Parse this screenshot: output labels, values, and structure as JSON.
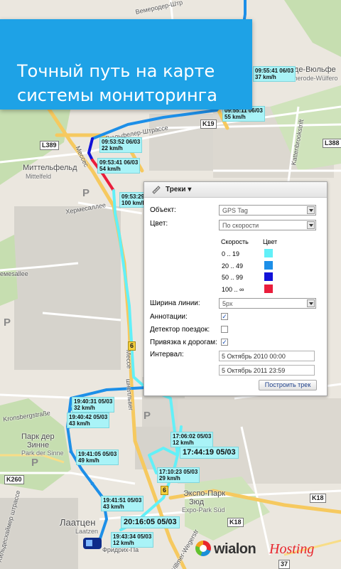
{
  "banner": {
    "line1": "Точный путь на карте",
    "line2": "системы мониторинга"
  },
  "map": {
    "places": [
      {
        "id": "mittelfeld",
        "text": "Миттельфельд"
      },
      {
        "id": "mittelfeld_de",
        "text": "Mittelfeld"
      },
      {
        "id": "bemerode",
        "text": "еroде-Вюльфе"
      },
      {
        "id": "bemerode_de",
        "text": "Bemerode-Wülfero"
      },
      {
        "id": "park_sinne",
        "text": "Парк дер"
      },
      {
        "id": "park_sinne2",
        "text": "Зинне"
      },
      {
        "id": "park_sinne_de",
        "text": "Park der Sinne"
      },
      {
        "id": "laatzen",
        "text": "Лаатцен"
      },
      {
        "id": "laatzen_de",
        "text": "Laatzen"
      },
      {
        "id": "expo",
        "text": "Экспо-Парк"
      },
      {
        "id": "expo2",
        "text": "Зюд"
      },
      {
        "id": "expo_de",
        "text": "Expo-Park Süd"
      }
    ],
    "streets": [
      {
        "id": "vemeroder",
        "text": "Вемеродер-Штр"
      },
      {
        "id": "wulfeler",
        "text": "Вюльфелер-Штрассе"
      },
      {
        "id": "hermes",
        "text": "Хермесаллее"
      },
      {
        "id": "kronsberg",
        "text": "Kronsbergstraße"
      },
      {
        "id": "hildes",
        "text": "Хильдесхаймер штрассе"
      },
      {
        "id": "kattenbrook",
        "text": "Kattenbrookstrift"
      },
      {
        "id": "messe",
        "text": "Мессе"
      },
      {
        "id": "messe2",
        "text": "шнелльвег"
      },
      {
        "id": "messe3",
        "text": "Мессес"
      },
      {
        "id": "emesallee",
        "text": "емesallee"
      },
      {
        "id": "willmer",
        "text": "Willmer-Wegerstr"
      },
      {
        "id": "frieder",
        "text": "Фридрих-Па"
      }
    ],
    "shields": [
      {
        "id": "l389",
        "text": "L389"
      },
      {
        "id": "l388",
        "text": "L388"
      },
      {
        "id": "k19",
        "text": "K19"
      },
      {
        "id": "s6a",
        "text": "6"
      },
      {
        "id": "s6b",
        "text": "6"
      },
      {
        "id": "s6c",
        "text": "6"
      },
      {
        "id": "k260",
        "text": "K260"
      },
      {
        "id": "k18",
        "text": "K18"
      },
      {
        "id": "s37",
        "text": "37"
      },
      {
        "id": "k18b",
        "text": "K18"
      }
    ],
    "parking": [
      "P",
      "P",
      "P",
      "P"
    ],
    "points": [
      {
        "id": "p1",
        "l1": "09:55:41 06/03",
        "l2": "37 km/h"
      },
      {
        "id": "p2",
        "l1": "09:55:11 06/03",
        "l2": "55 km/h"
      },
      {
        "id": "p3",
        "l1": "09:53:52 06/03",
        "l2": "22 km/h"
      },
      {
        "id": "p4",
        "l1": "09:53:41 06/03",
        "l2": "54 km/h"
      },
      {
        "id": "p5",
        "l1": "09:53:29",
        "l2": "100 km/h"
      },
      {
        "id": "p6",
        "l1": "19:40:31 05/03",
        "l2": "32 km/h"
      },
      {
        "id": "p7",
        "l1": "19:40:42 05/03",
        "l2": "43 km/h"
      },
      {
        "id": "p8",
        "l1": "19:41:05 05/03",
        "l2": "49 km/h"
      },
      {
        "id": "p9",
        "l1": "17:06:02 05/03",
        "l2": "12 km/h"
      },
      {
        "id": "p10",
        "l1": "17:44:19 05/03",
        "l2": ""
      },
      {
        "id": "p11",
        "l1": "17:10:23 05/03",
        "l2": "29 km/h"
      },
      {
        "id": "p12",
        "l1": "19:41:51 05/03",
        "l2": "43 km/h"
      },
      {
        "id": "p13",
        "l1": "20:16:05 05/03",
        "l2": ""
      },
      {
        "id": "p14",
        "l1": "19:43:34 05/03",
        "l2": "12 km/h"
      }
    ]
  },
  "panel": {
    "title": "Треки",
    "object_label": "Объект:",
    "object_value": "GPS Tag",
    "color_label": "Цвет:",
    "color_value": "По скорости",
    "speed_header": "Скорость",
    "color_header": "Цвет",
    "ranges": [
      {
        "label": "0 .. 19",
        "color": "#62f0f8"
      },
      {
        "label": "20 .. 49",
        "color": "#1d8fe8"
      },
      {
        "label": "50 .. 99",
        "color": "#1212d8"
      },
      {
        "label": "100 .. ∞",
        "color": "#ea1d3b"
      }
    ],
    "width_label": "Ширина линии:",
    "width_value": "5px",
    "annotations_label": "Аннотации:",
    "annotations_checked": true,
    "trip_label": "Детектор поездок:",
    "trip_checked": false,
    "snap_label": "Привязка к дорогам:",
    "snap_checked": true,
    "interval_label": "Интервал:",
    "interval_from": "5 Октябрь 2010 00:00",
    "interval_to": "5 Октябрь 2011 23:59",
    "build_button": "Построить трек"
  },
  "logo": {
    "part1": "wialon",
    "part2": "Hosting"
  },
  "colors": {
    "banner": "#1ea2e6",
    "track_slow": "#62f0f8",
    "track_mid": "#1d8fe8",
    "track_fast": "#1212d8",
    "track_top": "#ea1d3b"
  }
}
